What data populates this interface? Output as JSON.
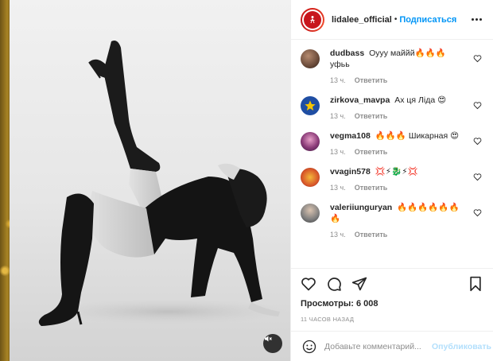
{
  "header": {
    "username": "lidalee_official",
    "separator": "•",
    "follow_label": "Подписаться"
  },
  "comments": [
    {
      "user": "dudbass",
      "text": "Оууу маййй🔥🔥🔥 уфьь",
      "time": "13 ч.",
      "reply": "Ответить",
      "avatar_color": "#6b4b3a"
    },
    {
      "user": "zirkova_mavpa",
      "text": "Ах ця Ліда 😍",
      "time": "13 ч.",
      "reply": "Ответить",
      "avatar_color": "#1f4ea3"
    },
    {
      "user": "vegma108",
      "text": "🔥🔥🔥 Шикарная 😍",
      "time": "13 ч.",
      "reply": "Ответить",
      "avatar_color": "#8a3b78"
    },
    {
      "user": "vvagin578",
      "text": "💢⚡🐉⚡💢",
      "time": "13 ч.",
      "reply": "Ответить",
      "avatar_color": "#d8572a"
    },
    {
      "user": "valeriiunguryan",
      "text": "🔥🔥🔥🔥🔥🔥 🔥",
      "time": "13 ч.",
      "reply": "Ответить",
      "avatar_color": "#7d7d7d"
    }
  ],
  "stats": {
    "views": "Просмотры: 6 008",
    "time_ago": "11 ЧАСОВ НАЗАД"
  },
  "composer": {
    "placeholder": "Добавьте комментарий...",
    "publish_label": "Опубликовать"
  },
  "icons": {
    "like": "heart-icon",
    "comment": "comment-icon",
    "share": "share-icon",
    "save": "bookmark-icon",
    "emoji": "emoji-icon",
    "more": "more-options-icon",
    "mute": "mute-icon"
  },
  "colors": {
    "brand_link": "#0095f6",
    "publish_disabled": "#b2dffc",
    "avatar_red": "#c8161d"
  }
}
